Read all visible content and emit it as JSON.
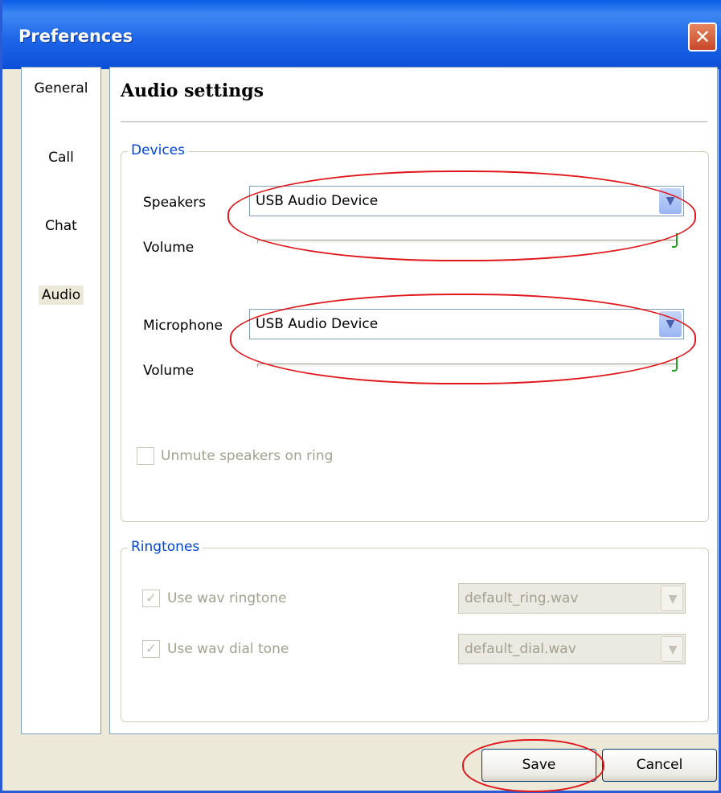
{
  "window": {
    "title": "Preferences",
    "close_glyph": "✕"
  },
  "nav": {
    "items": [
      {
        "label": "General"
      },
      {
        "label": "Call"
      },
      {
        "label": "Chat"
      },
      {
        "label": "Audio",
        "selected": true
      }
    ]
  },
  "page": {
    "heading": "Audio settings"
  },
  "devices": {
    "legend": "Devices",
    "speakers_label": "Speakers",
    "speakers_value": "USB Audio Device",
    "speakers_volume_label": "Volume",
    "speakers_volume_level": 1.0,
    "microphone_label": "Microphone",
    "microphone_value": "USB Audio Device",
    "microphone_volume_label": "Volume",
    "microphone_volume_level": 1.0,
    "unmute_label": "Unmute speakers on ring",
    "unmute_checked": false
  },
  "ringtones": {
    "legend": "Ringtones",
    "wav_ringtone_label": "Use wav ringtone",
    "wav_ringtone_checked": true,
    "wav_ringtone_file": "default_ring.wav",
    "wav_dial_label": "Use wav dial tone",
    "wav_dial_checked": true,
    "wav_dial_file": "default_dial.wav"
  },
  "footer": {
    "save_label": "Save",
    "cancel_label": "Cancel"
  },
  "icons": {
    "dropdown_arrow": "▼",
    "check": "✓"
  },
  "colors": {
    "title_bar": "#1f67e8",
    "legend_text": "#0046d5",
    "highlight_ring": "#e0161b",
    "slider_thumb": "#21a121"
  }
}
